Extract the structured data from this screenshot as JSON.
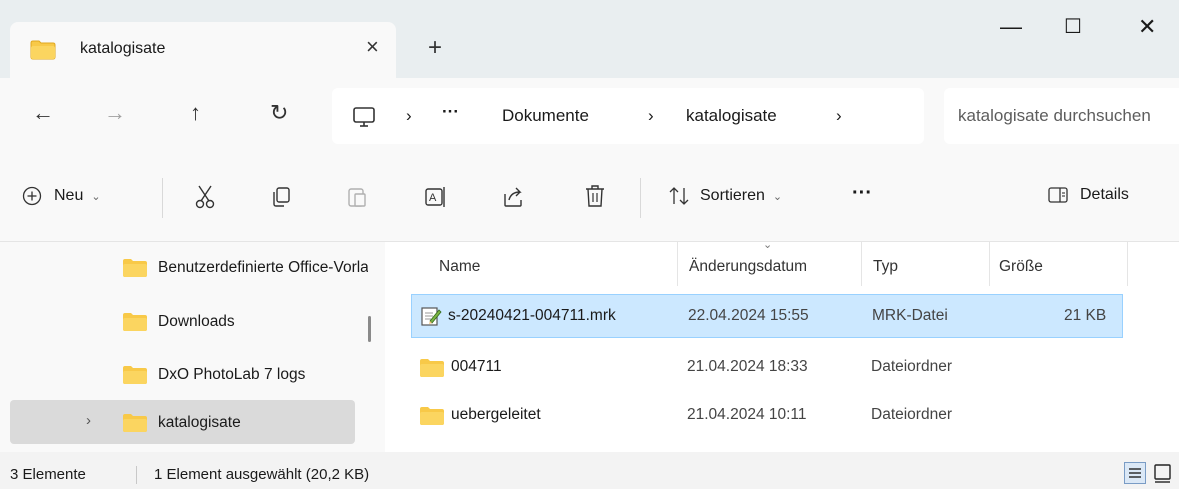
{
  "window": {
    "tab_title": "katalogisate",
    "tab_close": "×",
    "new_tab": "+",
    "minimize": "—",
    "maximize": "☐",
    "close": "✕"
  },
  "navigation": {
    "back": "←",
    "forward": "→",
    "up": "↑",
    "refresh": "↻",
    "more": "···",
    "breadcrumb": [
      "Dokumente",
      "katalogisate"
    ],
    "separator": "›",
    "search_placeholder": "katalogisate durchsuchen"
  },
  "toolbar": {
    "new_label": "Neu",
    "sort_label": "Sortieren",
    "more": "···",
    "details_label": "Details"
  },
  "sidebar": {
    "items": [
      {
        "label": "Benutzerdefinierte Office-Vorlagen"
      },
      {
        "label": "Downloads"
      },
      {
        "label": "DxO PhotoLab 7 logs"
      },
      {
        "label": "katalogisate",
        "expand": "›"
      }
    ]
  },
  "file_list": {
    "columns": [
      "Name",
      "Änderungsdatum",
      "Typ",
      "Größe"
    ],
    "rows": [
      {
        "name": "s-20240421-004711.mrk",
        "date": "22.04.2024 15:55",
        "type": "MRK-Datei",
        "size": "21 KB",
        "icon": "text-file-icon"
      },
      {
        "name": "004711",
        "date": "21.04.2024 18:33",
        "type": "Dateiordner",
        "size": "",
        "icon": "folder-icon"
      },
      {
        "name": "uebergeleitet",
        "date": "21.04.2024 10:11",
        "type": "Dateiordner",
        "size": "",
        "icon": "folder-icon"
      }
    ]
  },
  "status": {
    "count": "3 Elemente",
    "selection": "1 Element ausgewählt (20,2 KB)"
  },
  "colors": {
    "folder": "#f8c948",
    "selected_row": "#cce8ff",
    "selected_border": "#99d1ff"
  }
}
